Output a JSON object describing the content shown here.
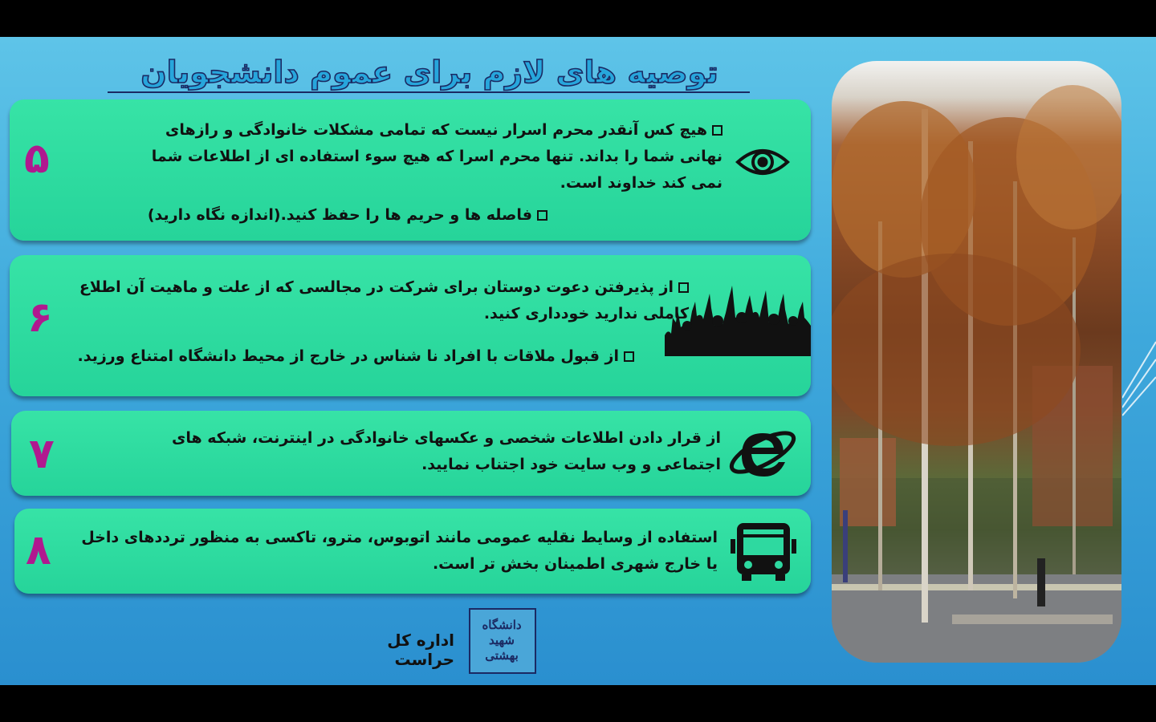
{
  "title": "توصیه های لازم برای عموم دانشجویان",
  "cards": [
    {
      "number": "۵",
      "icon": "eye-icon",
      "bullets": [
        "هیچ کس آنقدر محرم اسرار نیست که تمامی مشکلات خانوادگی و رازهای نهانی شما را بداند. تنها محرم اسرا که هیچ سوء استفاده ای از اطلاعات شما نمی کند خداوند است.",
        "فاصله ها و حریم ها را حفظ کنید.(اندازه نگاه دارید)"
      ]
    },
    {
      "number": "۶",
      "icon": "crowd-icon",
      "bullets": [
        "از پذیرفتن دعوت دوستان برای شرکت در مجالسی که از علت و ماهیت آن اطلاع کاملی ندارید خودداری کنید.",
        "از قبول ملاقات با افراد نا شناس در خارج از محیط دانشگاه امتناع ورزید."
      ]
    },
    {
      "number": "۷",
      "icon": "internet-explorer-icon",
      "text": "از قرار دادن اطلاعات شخصی و عکسهای خانوادگی در اینترنت، شبکه های اجتماعی و وب سایت خود اجتناب نمایید."
    },
    {
      "number": "۸",
      "icon": "bus-icon",
      "text": "استفاده از وسایط نقلیه عمومی مانند اتوبوس، مترو، تاکسی به منظور ترددهای داخل یا خارج شهری اطمینان بخش تر است."
    }
  ],
  "footer": {
    "office": "اداره کل حراست",
    "logo_text": "دانشگاه شهید بهشتی"
  },
  "colors": {
    "background": "#3fa9dc",
    "card": "#2ed9a0",
    "number": "#b0198f",
    "title_stroke": "#1b2a63"
  }
}
